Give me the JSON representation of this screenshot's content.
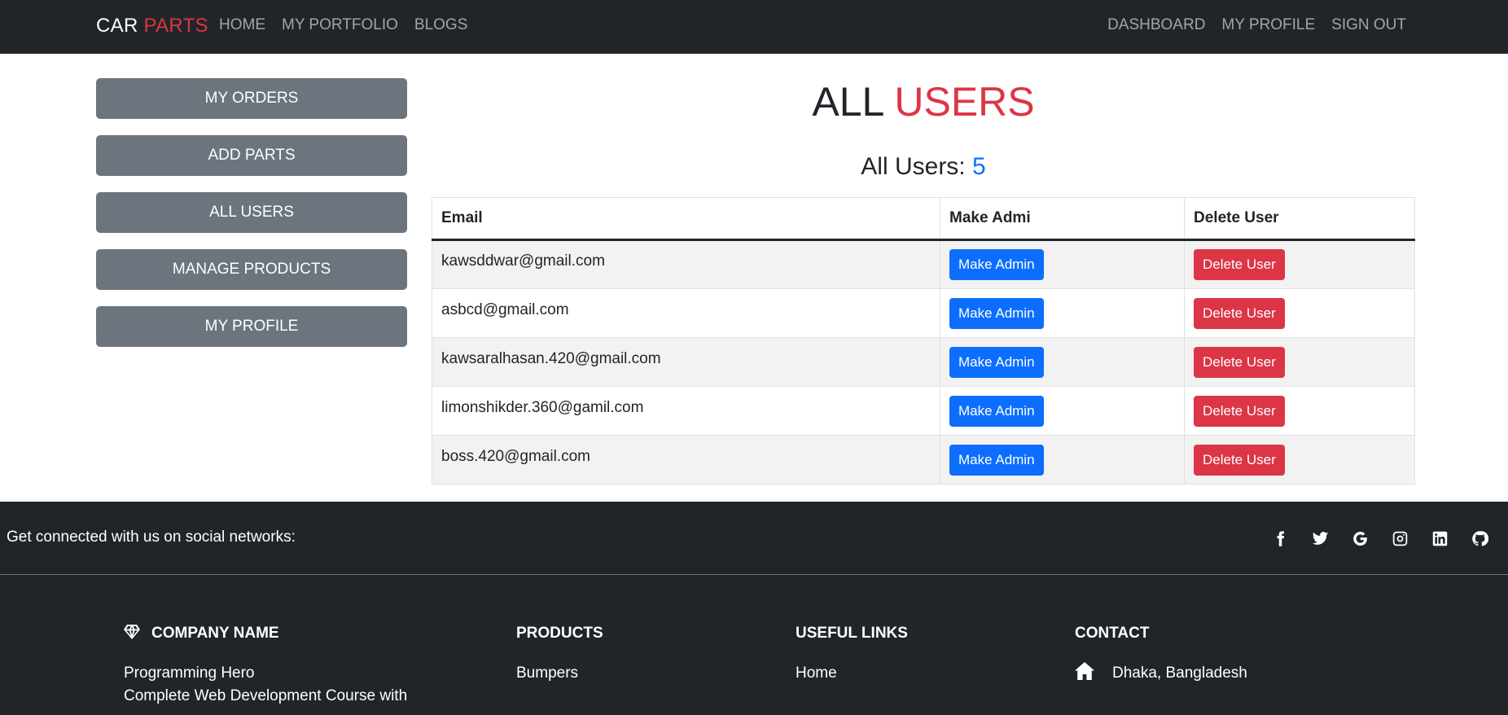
{
  "navbar": {
    "brand_main": "CAR",
    "brand_accent": "PARTS",
    "left_links": [
      "HOME",
      "MY PORTFOLIO",
      "BLOGS"
    ],
    "right_links": [
      "DASHBOARD",
      "MY PROFILE",
      "SIGN OUT"
    ]
  },
  "sidebar": {
    "items": [
      "MY ORDERS",
      "ADD PARTS",
      "ALL USERS",
      "MANAGE PRODUCTS",
      "MY PROFILE"
    ]
  },
  "main": {
    "title_main": "ALL",
    "title_accent": "USERS",
    "count_label": "All Users:",
    "count_value": "5"
  },
  "table": {
    "headers": [
      "Email",
      "Make Admi",
      "Delete User"
    ],
    "make_admin_label": "Make Admin",
    "delete_label": "Delete User",
    "rows": [
      {
        "email": "kawsddwar@gmail.com"
      },
      {
        "email": "asbcd@gmail.com"
      },
      {
        "email": "kawsaralhasan.420@gmail.com"
      },
      {
        "email": "limonshikder.360@gamil.com"
      },
      {
        "email": "boss.420@gmail.com"
      }
    ]
  },
  "footer": {
    "social_text": "Get connected with us on social networks:",
    "social_icons": [
      "facebook-icon",
      "twitter-icon",
      "google-icon",
      "instagram-icon",
      "linkedin-icon",
      "github-icon"
    ],
    "company": {
      "heading": "COMPANY NAME",
      "lines": [
        "Programming Hero",
        "Complete Web Development Course with"
      ]
    },
    "products": {
      "heading": "PRODUCTS",
      "items": [
        "Bumpers"
      ]
    },
    "useful_links": {
      "heading": "USEFUL LINKS",
      "items": [
        "Home"
      ]
    },
    "contact": {
      "heading": "CONTACT",
      "address": "Dhaka, Bangladesh"
    }
  },
  "colors": {
    "navbar_bg": "#212529",
    "accent_red": "#dc3545",
    "primary_blue": "#0d6efd",
    "sidebar_btn": "#6c757d"
  }
}
